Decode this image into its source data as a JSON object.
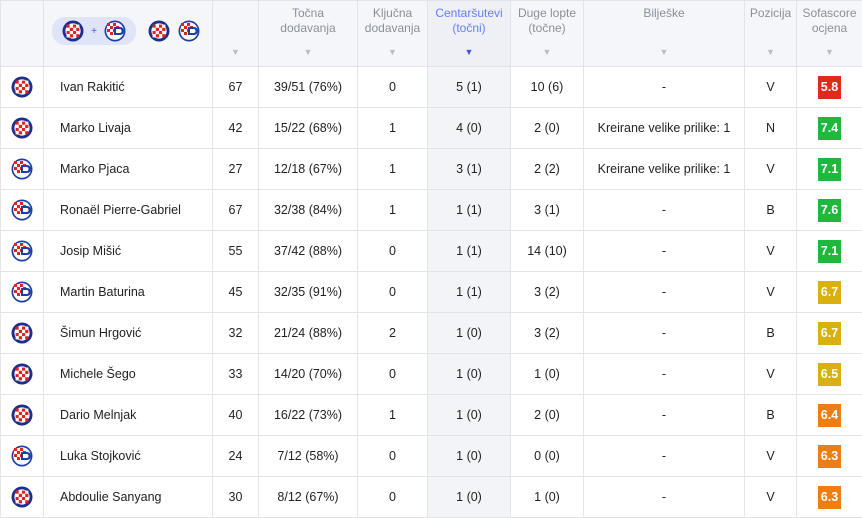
{
  "header": {
    "col_minutes": "",
    "col_accurate_passes": "Točna\ndodavanja",
    "col_key_passes": "Ključna\ndodavanja",
    "col_crosses": "Centaršutevi\n(točni)",
    "col_long_balls": "Duge lopte\n(točne)",
    "col_notes": "Bilješke",
    "col_position": "Pozicija",
    "col_rating": "Sofascore\nocjena",
    "sort_icon": "▼",
    "filter_plus": "+"
  },
  "colors": {
    "hajduk_blue": "#1d2f8c",
    "hajduk_red": "#e1221f",
    "dinamo_blue": "#1c3fa7",
    "rating_red": "#e02a19",
    "rating_green": "#1eb83c",
    "rating_yellow": "#d9b00f",
    "rating_orange": "#ee7e12",
    "sort_active": "#3e55e6"
  },
  "rows": [
    {
      "team": "hajduk",
      "name": "Ivan Rakitić",
      "minutes": "67",
      "passes": "39/51 (76%)",
      "key": "0",
      "crosses": "5 (1)",
      "long": "10 (6)",
      "notes": "-",
      "pos": "V",
      "rating": "5.8",
      "color": "#e02a19"
    },
    {
      "team": "hajduk",
      "name": "Marko Livaja",
      "minutes": "42",
      "passes": "15/22 (68%)",
      "key": "1",
      "crosses": "4 (0)",
      "long": "2 (0)",
      "notes": "Kreirane velike prilike: 1",
      "pos": "N",
      "rating": "7.4",
      "color": "#1eb83c"
    },
    {
      "team": "dinamo",
      "name": "Marko Pjaca",
      "minutes": "27",
      "passes": "12/18 (67%)",
      "key": "1",
      "crosses": "3 (1)",
      "long": "2 (2)",
      "notes": "Kreirane velike prilike: 1",
      "pos": "V",
      "rating": "7.1",
      "color": "#1eb83c"
    },
    {
      "team": "dinamo",
      "name": "Ronaël Pierre-Gabriel",
      "minutes": "67",
      "passes": "32/38 (84%)",
      "key": "1",
      "crosses": "1 (1)",
      "long": "3 (1)",
      "notes": "-",
      "pos": "B",
      "rating": "7.6",
      "color": "#1eb83c"
    },
    {
      "team": "dinamo",
      "name": "Josip Mišić",
      "minutes": "55",
      "passes": "37/42 (88%)",
      "key": "0",
      "crosses": "1 (1)",
      "long": "14 (10)",
      "notes": "-",
      "pos": "V",
      "rating": "7.1",
      "color": "#1eb83c"
    },
    {
      "team": "dinamo",
      "name": "Martin Baturina",
      "minutes": "45",
      "passes": "32/35 (91%)",
      "key": "0",
      "crosses": "1 (1)",
      "long": "3 (2)",
      "notes": "-",
      "pos": "V",
      "rating": "6.7",
      "color": "#d9b00f"
    },
    {
      "team": "hajduk",
      "name": "Šimun Hrgović",
      "minutes": "32",
      "passes": "21/24 (88%)",
      "key": "2",
      "crosses": "1 (0)",
      "long": "3 (2)",
      "notes": "-",
      "pos": "B",
      "rating": "6.7",
      "color": "#d9b00f"
    },
    {
      "team": "hajduk",
      "name": "Michele Šego",
      "minutes": "33",
      "passes": "14/20 (70%)",
      "key": "0",
      "crosses": "1 (0)",
      "long": "1 (0)",
      "notes": "-",
      "pos": "V",
      "rating": "6.5",
      "color": "#d9b00f"
    },
    {
      "team": "hajduk",
      "name": "Dario Melnjak",
      "minutes": "40",
      "passes": "16/22 (73%)",
      "key": "1",
      "crosses": "1 (0)",
      "long": "2 (0)",
      "notes": "-",
      "pos": "B",
      "rating": "6.4",
      "color": "#ee7e12"
    },
    {
      "team": "dinamo",
      "name": "Luka Stojković",
      "minutes": "24",
      "passes": "7/12 (58%)",
      "key": "0",
      "crosses": "1 (0)",
      "long": "0 (0)",
      "notes": "-",
      "pos": "V",
      "rating": "6.3",
      "color": "#ee7e12"
    },
    {
      "team": "hajduk",
      "name": "Abdoulie Sanyang",
      "minutes": "30",
      "passes": "8/12 (67%)",
      "key": "0",
      "crosses": "1 (0)",
      "long": "1 (0)",
      "notes": "-",
      "pos": "V",
      "rating": "6.3",
      "color": "#ee7e12"
    }
  ]
}
